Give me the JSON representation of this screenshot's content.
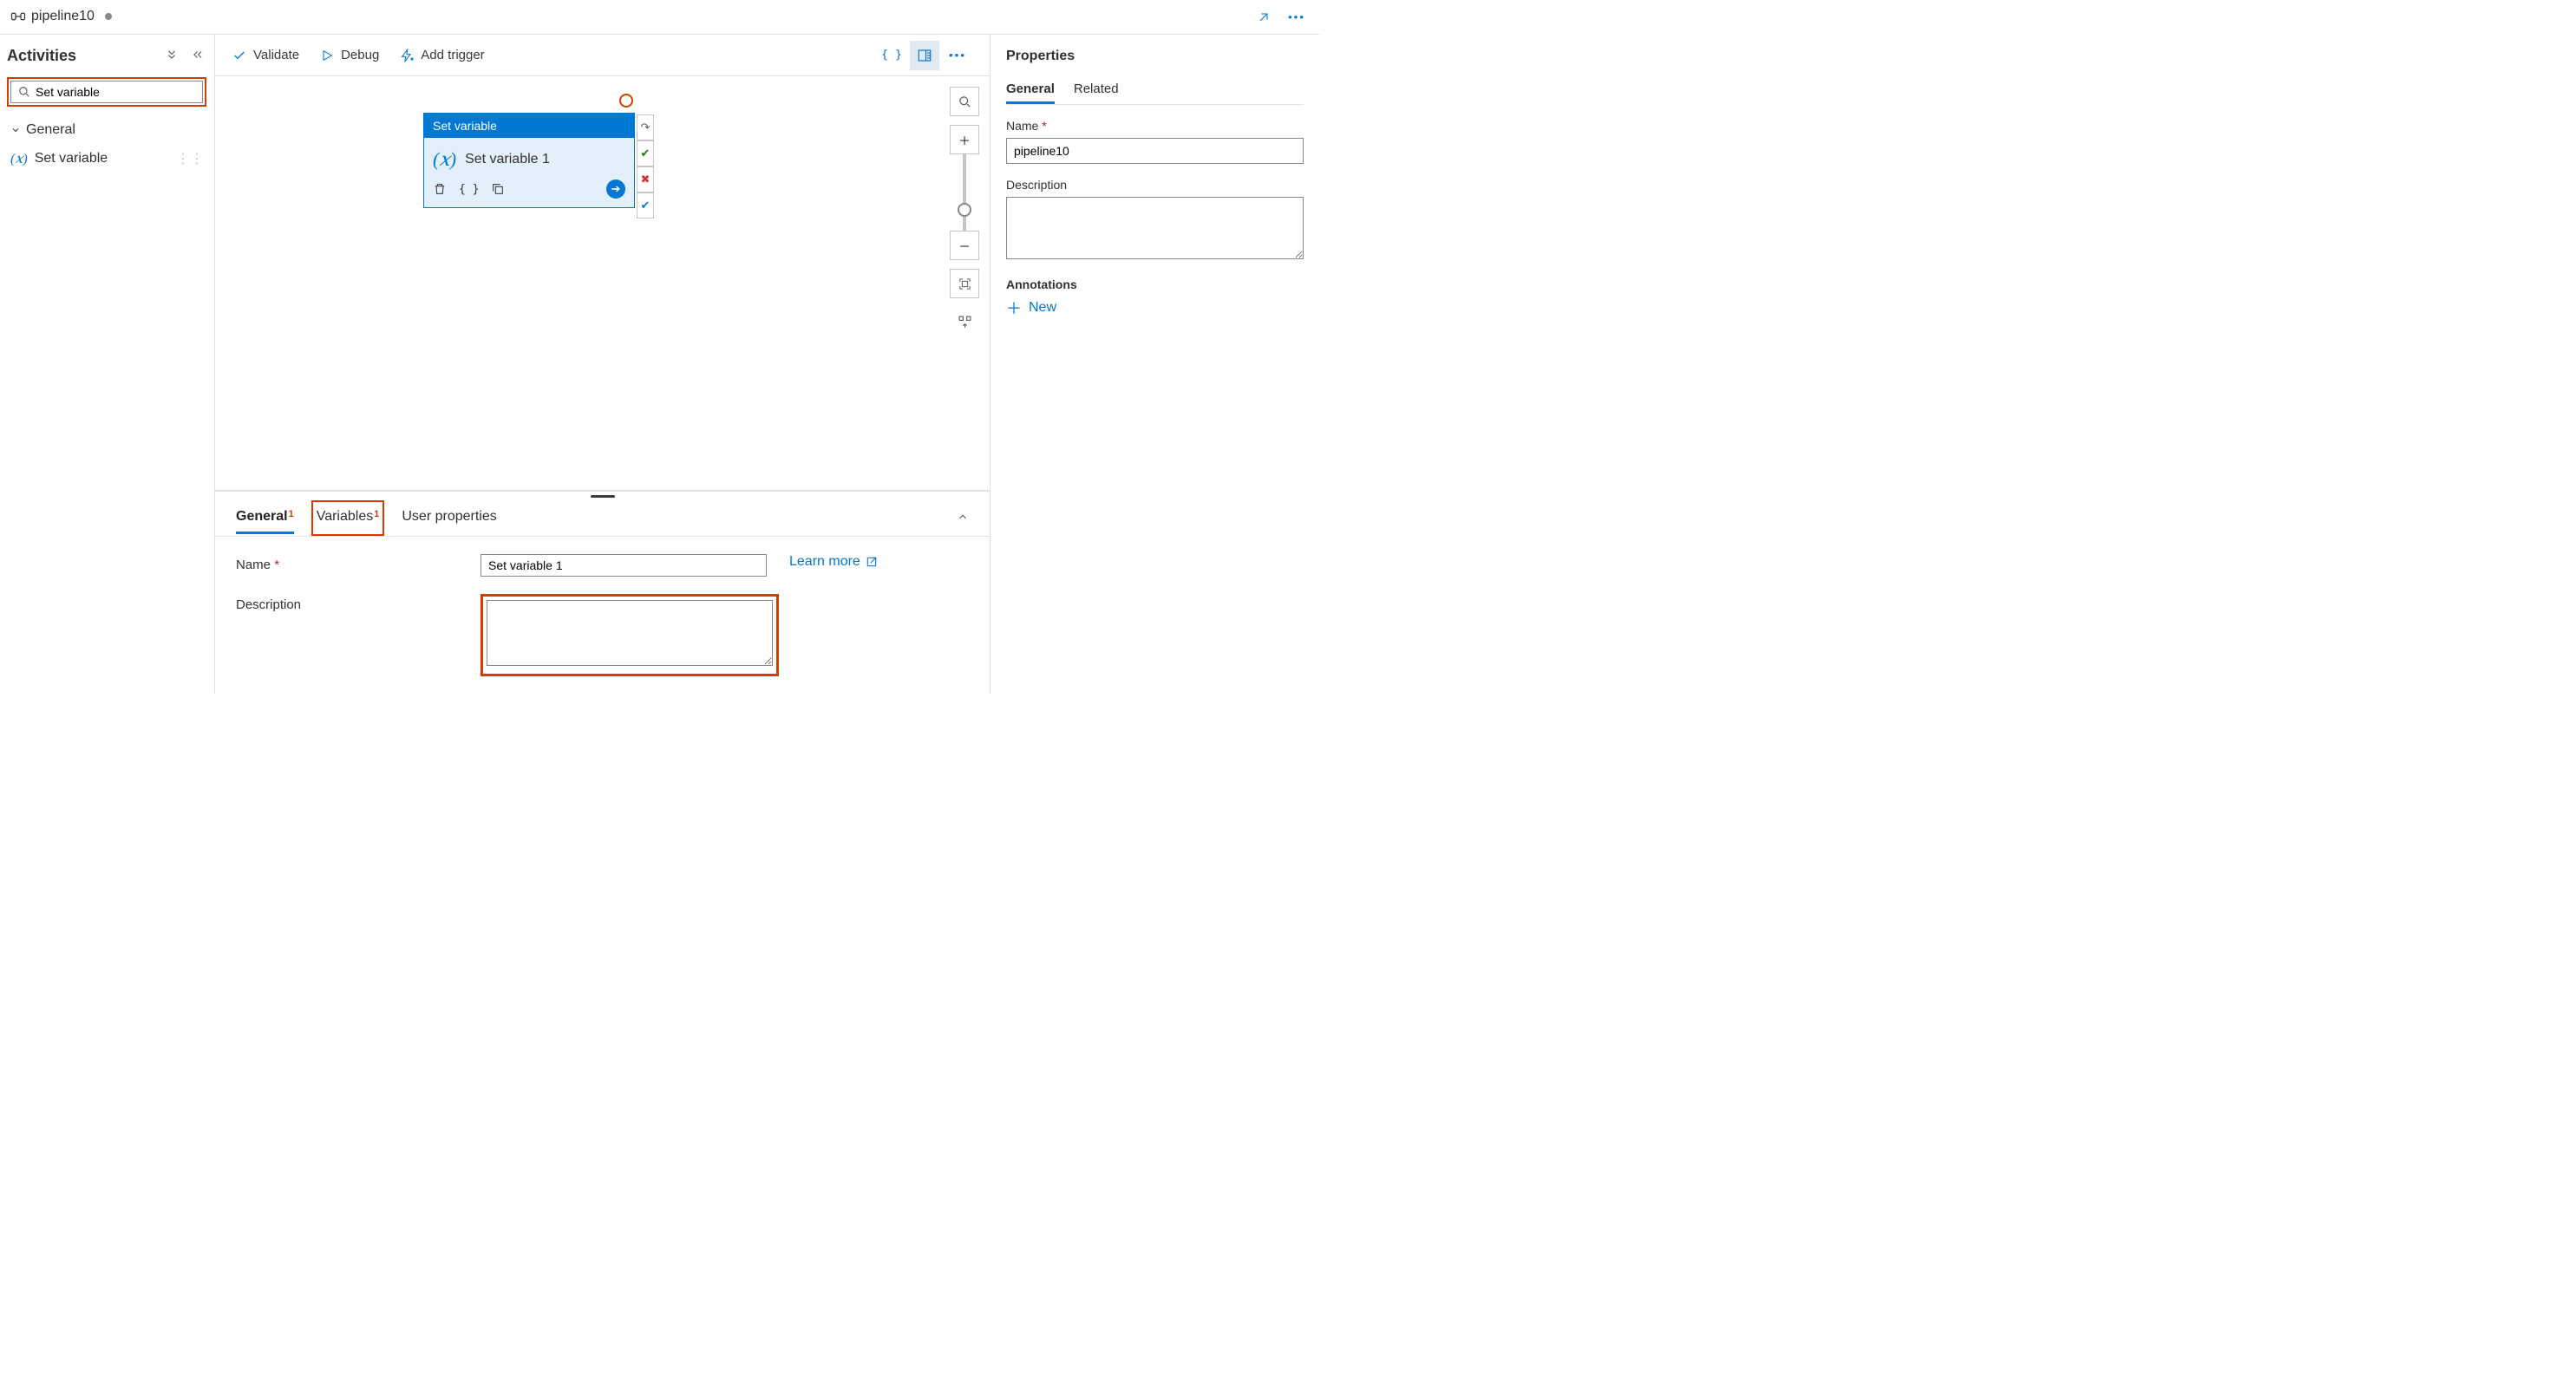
{
  "header": {
    "pipeline_name": "pipeline10",
    "dirty": true
  },
  "activities": {
    "title": "Activities",
    "search_value": "Set variable",
    "group_label": "General",
    "item_label": "Set variable"
  },
  "toolbar": {
    "validate": "Validate",
    "debug": "Debug",
    "add_trigger": "Add trigger"
  },
  "canvas": {
    "node_type": "Set variable",
    "node_name": "Set variable 1"
  },
  "bottom": {
    "tab_general": "General",
    "tab_variables": "Variables",
    "tab_user_properties": "User properties",
    "badge": "1",
    "form_name_label": "Name",
    "form_name_value": "Set variable 1",
    "form_description_label": "Description",
    "form_description_value": "",
    "learn_more": "Learn more"
  },
  "properties": {
    "title": "Properties",
    "tab_general": "General",
    "tab_related": "Related",
    "name_label": "Name",
    "name_value": "pipeline10",
    "description_label": "Description",
    "description_value": "",
    "annotations_label": "Annotations",
    "new_label": "New"
  }
}
